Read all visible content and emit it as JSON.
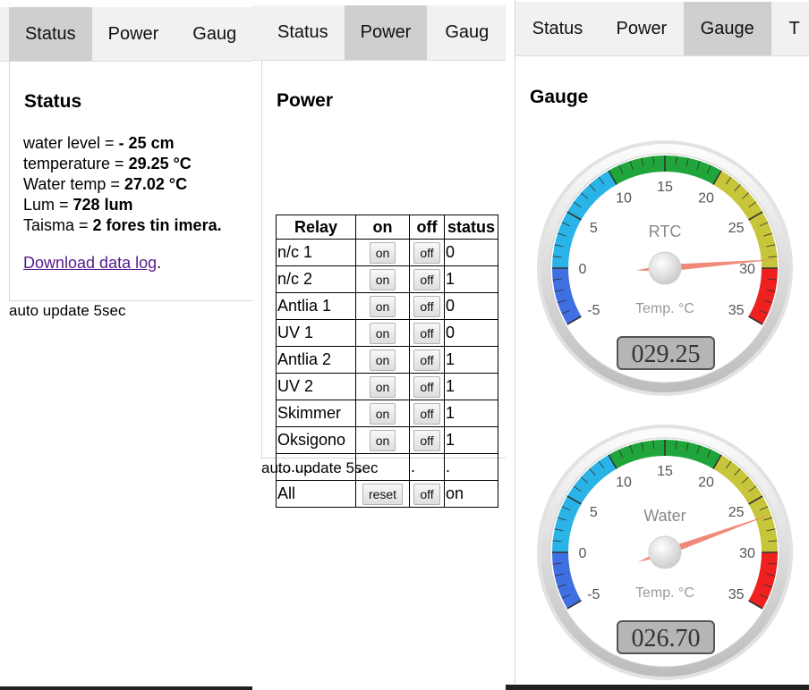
{
  "tabs": [
    "Status",
    "Power",
    "Gauge"
  ],
  "tabs_partial": [
    "Gaug",
    "Gaug",
    "T"
  ],
  "status_panel": {
    "title": "Status",
    "rows": [
      {
        "label": "water level = ",
        "value": "- 25 cm"
      },
      {
        "label": "temperature = ",
        "value": "29.25 °C"
      },
      {
        "label": "Water temp = ",
        "value": "27.02 °C"
      },
      {
        "label": "Lum = ",
        "value": "728 lum"
      },
      {
        "label": "Taisma = ",
        "value": "2 fores tin imera."
      }
    ],
    "download_link": "Download data log",
    "download_suffix": ".",
    "footer": "auto update 5sec"
  },
  "power_panel": {
    "title": "Power",
    "headers": [
      "Relay",
      "on",
      "off",
      "status"
    ],
    "rows": [
      {
        "name": "n/c 1",
        "on": "on",
        "off": "off",
        "status": "0"
      },
      {
        "name": "n/c 2",
        "on": "on",
        "off": "off",
        "status": "1"
      },
      {
        "name": "Antlia 1",
        "on": "on",
        "off": "off",
        "status": "0"
      },
      {
        "name": "UV 1",
        "on": "on",
        "off": "off",
        "status": "0"
      },
      {
        "name": "Antlia 2",
        "on": "on",
        "off": "off",
        "status": "1"
      },
      {
        "name": "UV 2",
        "on": "on",
        "off": "off",
        "status": "1"
      },
      {
        "name": "Skimmer",
        "on": "on",
        "off": "off",
        "status": "1"
      },
      {
        "name": "Oksigono",
        "on": "on",
        "off": "off",
        "status": "1"
      }
    ],
    "dots_row": {
      "name": "........",
      "on": ".",
      "off": ".",
      "status": "."
    },
    "all_row": {
      "name": "All",
      "on": "reset",
      "off": "off",
      "status": "on"
    },
    "footer": "auto update 5sec"
  },
  "gauge_panel": {
    "title": "Gauge",
    "gauges": [
      {
        "title": "RTC",
        "units": "Temp. °C",
        "value": 29.25,
        "display": "029.25",
        "ticks": [
          "-5",
          "0",
          "5",
          "10",
          "15",
          "20",
          "25",
          "30",
          "35"
        ]
      },
      {
        "title": "Water",
        "units": "Temp. °C",
        "value": 26.7,
        "display": "026.70",
        "ticks": [
          "-5",
          "0",
          "5",
          "10",
          "15",
          "20",
          "25",
          "30",
          "35"
        ]
      }
    ],
    "min": -5,
    "max": 35,
    "highlights": [
      {
        "from": -5,
        "to": 0,
        "color": "#3f6fe0"
      },
      {
        "from": 0,
        "to": 10,
        "color": "#2ab3e6"
      },
      {
        "from": 10,
        "to": 20,
        "color": "#1fa53a"
      },
      {
        "from": 20,
        "to": 30,
        "color": "#c7c53a"
      },
      {
        "from": 30,
        "to": 35,
        "color": "#ee2020"
      }
    ]
  },
  "colors": {
    "tab_bg": "#f1f1f1",
    "tab_active": "#cfcfcf",
    "link": "#551a8b",
    "needle": "#f07c6b"
  }
}
